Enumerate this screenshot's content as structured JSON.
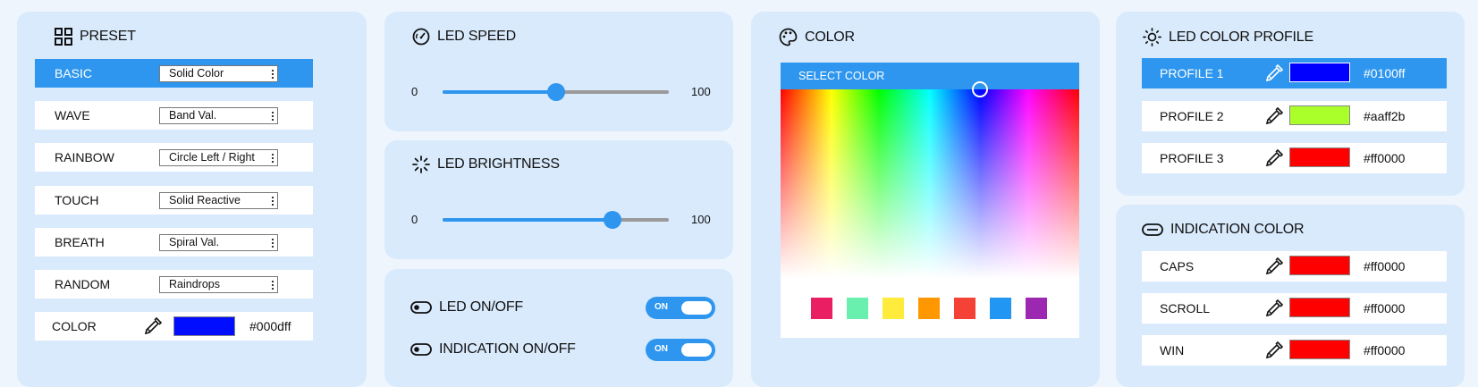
{
  "preset": {
    "title": "PRESET",
    "rows": [
      {
        "label": "BASIC",
        "value": "Solid Color"
      },
      {
        "label": "WAVE",
        "value": "Band Val."
      },
      {
        "label": "RAINBOW",
        "value": "Circle Left / Right"
      },
      {
        "label": "TOUCH",
        "value": "Solid Reactive"
      },
      {
        "label": "BREATH",
        "value": "Spiral Val."
      },
      {
        "label": "RANDOM",
        "value": "Raindrops"
      }
    ],
    "color_label": "COLOR",
    "color_hex": "#000dff",
    "color_value": "#000dff"
  },
  "led_speed": {
    "title": "LED SPEED",
    "min": "0",
    "max": "100",
    "value": 50
  },
  "led_brightness": {
    "title": "LED BRIGHTNESS",
    "min": "0",
    "max": "100",
    "value": 75
  },
  "toggles": {
    "led": {
      "label": "LED ON/OFF",
      "state": "ON"
    },
    "indication": {
      "label": "INDICATION ON/OFF",
      "state": "ON"
    }
  },
  "color_panel": {
    "title": "COLOR",
    "select_label": "SELECT COLOR",
    "swatches": [
      "#e91e63",
      "#69f0ae",
      "#ffeb3b",
      "#ff9800",
      "#f44336",
      "#2196f3",
      "#9c27b0"
    ]
  },
  "led_profile": {
    "title": "LED COLOR PROFILE",
    "rows": [
      {
        "label": "PROFILE 1",
        "hex": "#0100ff",
        "color": "#0100ff"
      },
      {
        "label": "PROFILE 2",
        "hex": "#aaff2b",
        "color": "#aaff2b"
      },
      {
        "label": "PROFILE 3",
        "hex": "#ff0000",
        "color": "#ff0000"
      }
    ]
  },
  "indication": {
    "title": "INDICATION COLOR",
    "rows": [
      {
        "label": "CAPS",
        "hex": "#ff0000",
        "color": "#ff0000"
      },
      {
        "label": "SCROLL",
        "hex": "#ff0000",
        "color": "#ff0000"
      },
      {
        "label": "WIN",
        "hex": "#ff0000",
        "color": "#ff0000"
      }
    ]
  },
  "colors": {
    "accent": "#2e96ee",
    "panel": "#d9eafc",
    "page": "#eef5fd"
  }
}
